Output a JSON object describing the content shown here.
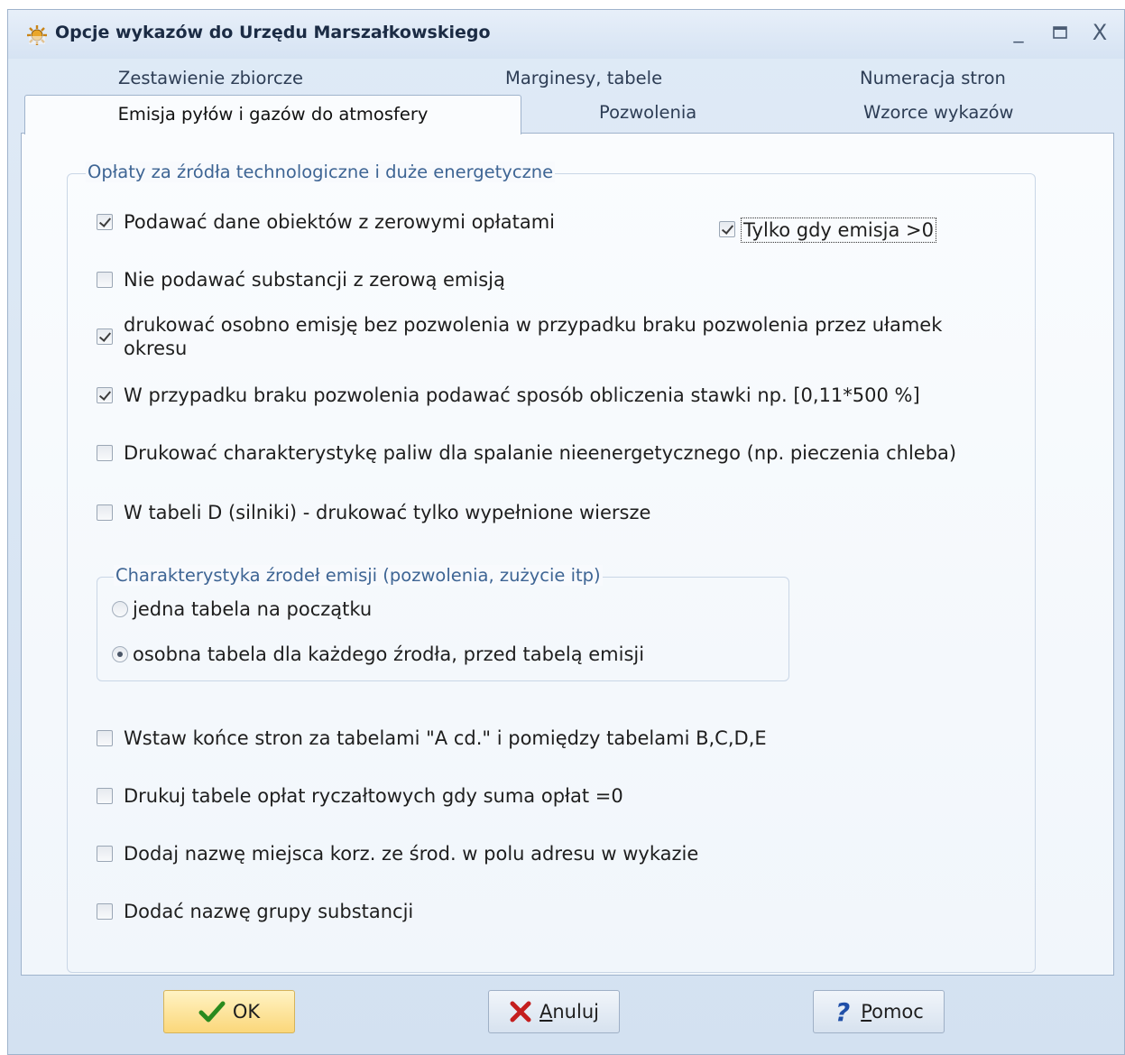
{
  "window": {
    "title": "Opcje wykazów do Urzędu Marszałkowskiego",
    "minimize": "_",
    "close": "X"
  },
  "tabs": {
    "back_row": [
      "Zestawienie zbiorcze",
      "Marginesy, tabele",
      "Numeracja stron"
    ],
    "front_row": [
      "Emisja pyłów i gazów do atmosfery",
      "Pozwolenia",
      "Wzorce wykazów"
    ],
    "active": "Emisja pyłów i gazów do atmosfery"
  },
  "main_group": {
    "legend": "Opłaty za źródła technologiczne i duże energetyczne",
    "options": [
      {
        "label": "Podawać dane obiektów z zerowymi opłatami",
        "checked": true
      },
      {
        "label": "Nie podawać substancji z zerową emisją",
        "checked": false
      },
      {
        "label": "drukować osobno emisję bez pozwolenia w przypadku braku pozwolenia przez ułamek okresu",
        "checked": true
      },
      {
        "label": "W przypadku braku pozwolenia podawać sposób obliczenia stawki np. [0,11*500 %]",
        "checked": true
      },
      {
        "label": "Drukować charakterystykę paliw dla spalanie nieenergetycznego (np. pieczenia chleba)",
        "checked": false
      },
      {
        "label": "W  tabeli D (silniki) - drukować tylko wypełnione wiersze",
        "checked": false
      }
    ],
    "side_option": {
      "label": "Tylko gdy emisja  >0",
      "checked": true
    },
    "radio_group": {
      "legend": "Charakterystyka źrodeł emisji (pozwolenia, zużycie itp)",
      "options": [
        {
          "label": "jedna tabela na początku",
          "selected": false
        },
        {
          "label": "osobna tabela dla każdego źrodła, przed tabelą emisji",
          "selected": true
        }
      ]
    },
    "options_lower": [
      {
        "label": "Wstaw końce stron za tabelami \"A cd.\" i pomiędzy tabelami B,C,D,E",
        "checked": false
      },
      {
        "label": "Drukuj tabele opłat ryczałtowych  gdy suma opłat =0",
        "checked": false
      },
      {
        "label": "Dodaj nazwę miejsca korz. ze środ. w polu adresu w wykazie",
        "checked": false
      },
      {
        "label": "Dodać nazwę grupy substancji",
        "checked": false
      }
    ]
  },
  "buttons": {
    "ok": "OK",
    "cancel_first": "A",
    "cancel_rest": "nuluj",
    "help_first": "P",
    "help_rest": "omoc"
  },
  "colors": {
    "accent_text": "#3e6594",
    "ok_button": "#fbd77a",
    "cancel_icon": "#c41e1e",
    "help_icon": "#1f4fa8"
  }
}
